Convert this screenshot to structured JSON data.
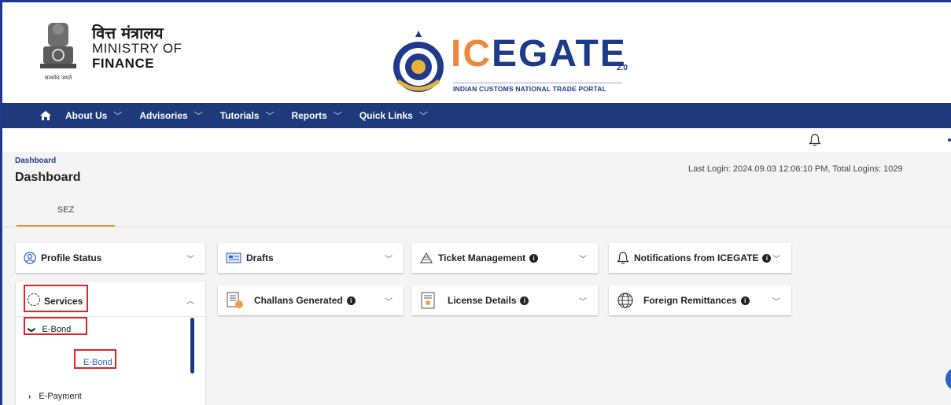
{
  "header": {
    "ministry_hindi": "वित्त मंत्रालय",
    "ministry_line1": "MINISTRY OF",
    "ministry_line2": "FINANCE",
    "emblem_motto": "सत्यमेव जयते",
    "brand_ic": "IC",
    "brand_gate": "EGATE",
    "brand_version": "2.0",
    "brand_subtitle": "INDIAN CUSTOMS NATIONAL TRADE PORTAL"
  },
  "nav": {
    "home_icon": "home-icon",
    "items": [
      {
        "label": "About Us"
      },
      {
        "label": "Advisories"
      },
      {
        "label": "Tutorials"
      },
      {
        "label": "Reports"
      },
      {
        "label": "Quick Links"
      }
    ]
  },
  "page": {
    "breadcrumb": "Dashboard",
    "title": "Dashboard",
    "last_login": "Last Login: 2024.09.03 12:06:10 PM, Total Logins: 1029",
    "tab": "SEZ"
  },
  "cards": {
    "profile": "Profile Status",
    "drafts": "Drafts",
    "ticket": "Ticket Management",
    "notifications": "Notifications from ICEGATE",
    "challans": "Challans Generated",
    "license": "License Details",
    "remittances": "Foreign Remittances"
  },
  "services": {
    "label": "Services",
    "ebond_group": "E-Bond",
    "ebond_leaf": "E-Bond",
    "epayment": "E-Payment"
  },
  "colors": {
    "nav_bg": "#1f3a7c",
    "accent_orange": "#f0883c",
    "highlight_red": "#e32424",
    "link_blue": "#2a64c8"
  }
}
